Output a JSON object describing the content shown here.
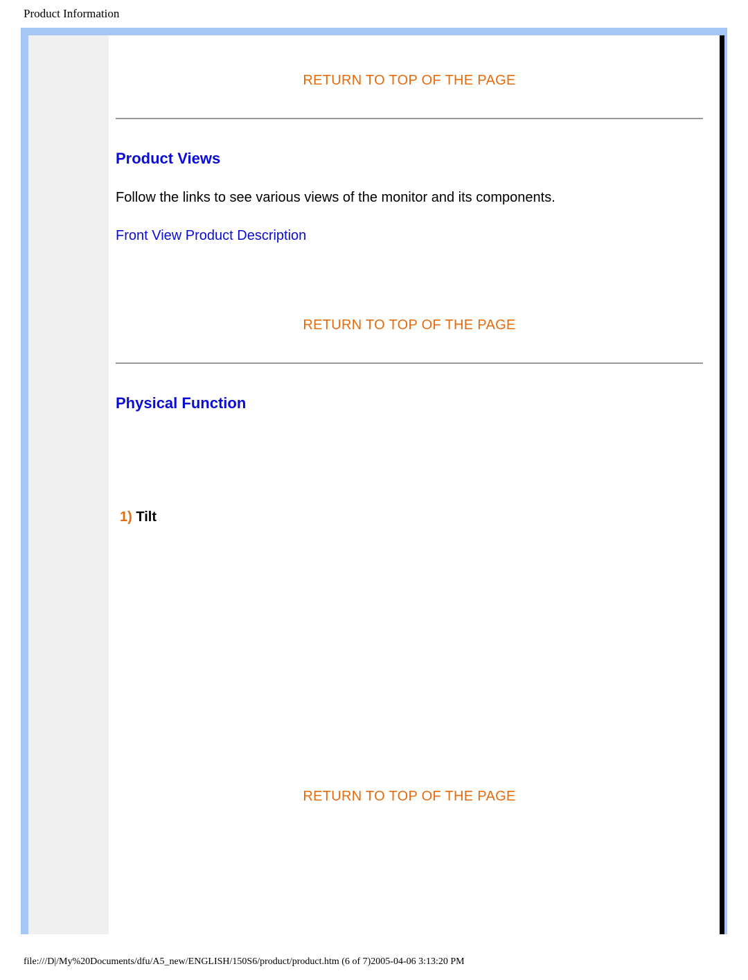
{
  "header": {
    "title": "Product Information"
  },
  "links": {
    "return_top": "RETURN TO TOP OF THE PAGE",
    "front_view": "Front View Product Description"
  },
  "sections": {
    "product_views": {
      "heading": "Product Views",
      "body": "Follow the links to see various views of the monitor and its components."
    },
    "physical_function": {
      "heading": "Physical Function",
      "item_num": "1)",
      "item_label": " Tilt"
    }
  },
  "footer": {
    "path": "file:///D|/My%20Documents/dfu/A5_new/ENGLISH/150S6/product/product.htm (6 of 7)2005-04-06 3:13:20 PM"
  }
}
